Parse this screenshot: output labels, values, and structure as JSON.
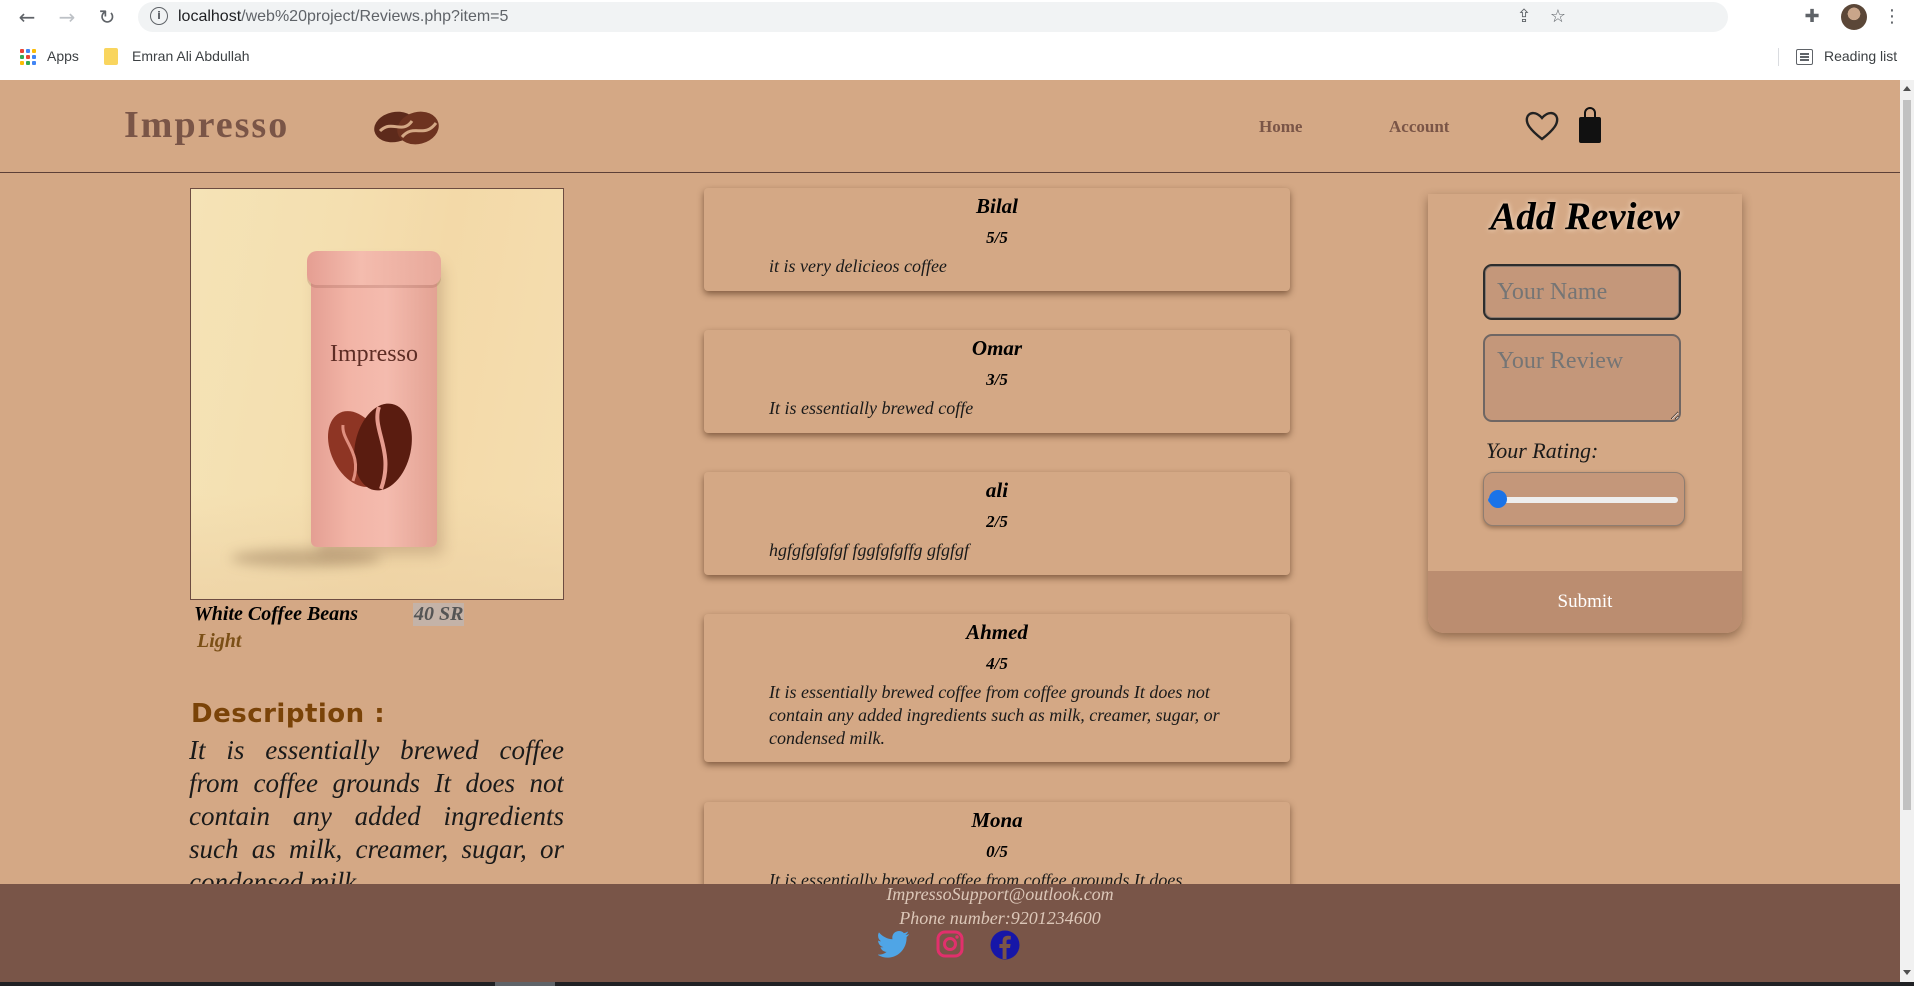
{
  "browser": {
    "url_host": "localhost",
    "url_path": "/web%20project/Reviews.php?item=5",
    "bookmarks": [
      "Apps",
      "Emran Ali Abdullah"
    ],
    "reading_list": "Reading list"
  },
  "header": {
    "brand": "Impresso",
    "nav": [
      "Home",
      "Account"
    ]
  },
  "product": {
    "image_label": "Impresso",
    "name": "White Coffee Beans",
    "price": "40 SR",
    "roast": "Light",
    "description_title": "Description :",
    "description": "It is essentially brewed coffee from coffee grounds It does not contain any added ingredients such as milk, creamer, sugar, or condensed milk."
  },
  "reviews": [
    {
      "name": "Bilal",
      "rating": "5/5",
      "text": "it is very delicieos coffee"
    },
    {
      "name": "Omar",
      "rating": "3/5",
      "text": "It is essentially brewed coffe"
    },
    {
      "name": "ali",
      "rating": "2/5",
      "text": "hgfgfgfgfgf fggfgfgffg gfgfgf"
    },
    {
      "name": "Ahmed",
      "rating": "4/5",
      "text": "It is essentially brewed coffee from coffee grounds It does not contain any added ingredients such as milk, creamer, sugar, or condensed milk."
    },
    {
      "name": "Mona",
      "rating": "0/5",
      "text": "It is essentially brewed coffee from coffee grounds It does"
    }
  ],
  "review_form": {
    "title": "Add Review",
    "name_placeholder": "Your Name",
    "review_placeholder": "Your Review",
    "rating_label": "Your Rating:",
    "rating_value": 0,
    "submit": "Submit"
  },
  "footer": {
    "email": "ImpressoSupport@outlook.com",
    "phone": "Phone number:9201234600",
    "social": [
      "twitter-icon",
      "instagram-icon",
      "facebook-icon"
    ]
  },
  "colors": {
    "page_bg": "#d4a885",
    "brand": "#7a5547",
    "footer_bg": "#795548",
    "accent_blue": "#1a73e8"
  }
}
